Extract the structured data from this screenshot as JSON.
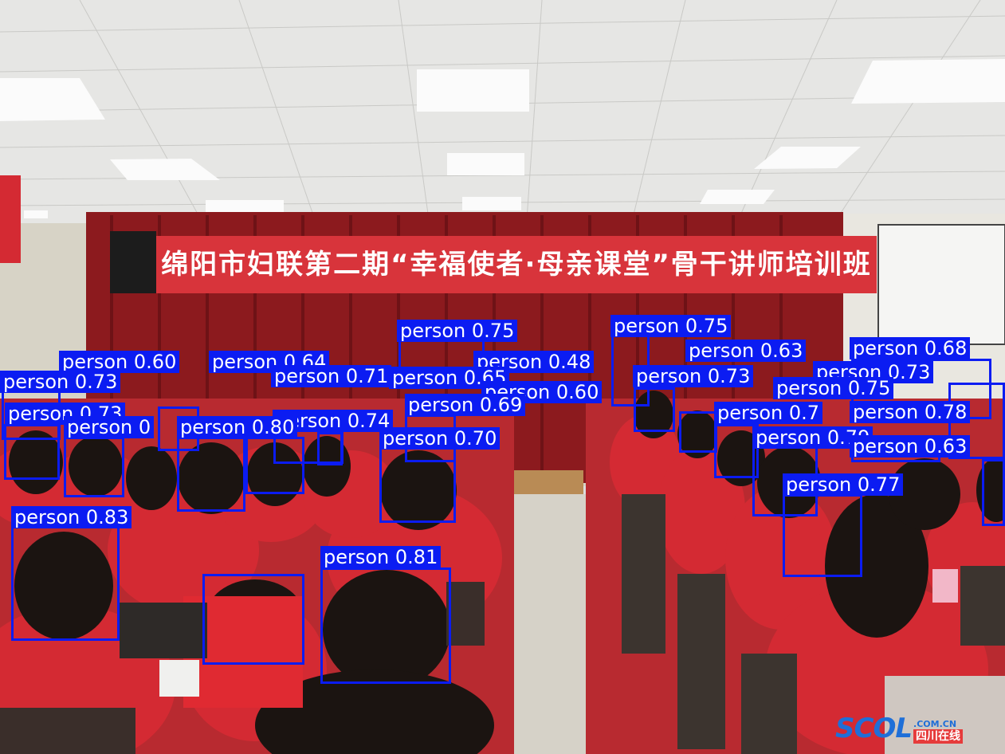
{
  "banner": {
    "text": "绵阳市妇联第二期“幸福使者·母亲课堂”骨干讲师培训班"
  },
  "watermark": {
    "logo": "SCOL",
    "domain": ".COM.CN",
    "cn": "四川在线"
  },
  "colors": {
    "box": "#0b1cf2",
    "banner": "#d8343b",
    "vest": "#d42a33",
    "curtain": "#8c1a1e"
  },
  "detections": [
    {
      "label": "person 0.75"
    },
    {
      "label": "person 0.75"
    },
    {
      "label": "person 0.68"
    },
    {
      "label": "person 0.73"
    },
    {
      "label": "person 0.60"
    },
    {
      "label": "person 0.64"
    },
    {
      "label": "person 0.71"
    },
    {
      "label": "person 0.65"
    },
    {
      "label": "person 0.48"
    },
    {
      "label": "person 0.60"
    },
    {
      "label": "person 0.73"
    },
    {
      "label": "person 0.63"
    },
    {
      "label": "person 0.73"
    },
    {
      "label": "person 0.75"
    },
    {
      "label": "person 0.69"
    },
    {
      "label": "person 0.73"
    },
    {
      "label": "person 0.74"
    },
    {
      "label": "person 0.80"
    },
    {
      "label": "person 0.7"
    },
    {
      "label": "person 0.78"
    },
    {
      "label": "person 0.70"
    },
    {
      "label": "person 0.79"
    },
    {
      "label": "person 0.63"
    },
    {
      "label": "person 0.77"
    },
    {
      "label": "person 0.83"
    },
    {
      "label": "person 0.81"
    },
    {
      "label": "person 0"
    }
  ]
}
